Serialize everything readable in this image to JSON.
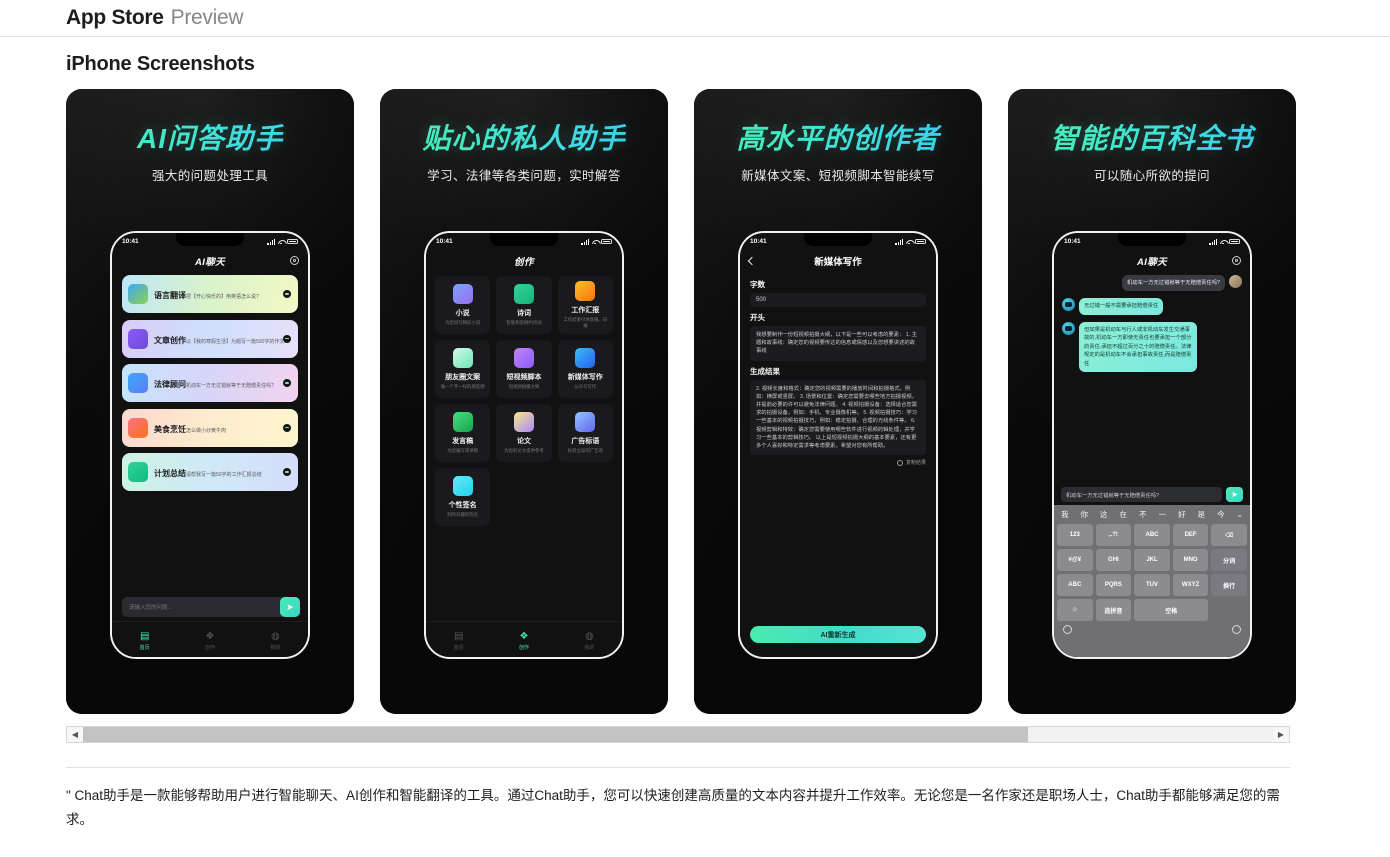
{
  "header": {
    "brand": "App Store",
    "preview": "Preview"
  },
  "section": {
    "title": "iPhone Screenshots"
  },
  "scrollbar": {
    "left_arrow": "◀",
    "right_arrow": "▶"
  },
  "footer": {
    "description": "\" Chat助手是一款能够帮助用户进行智能聊天、AI创作和智能翻译的工具。通过Chat助手，您可以快速创建高质量的文本内容并提升工作效率。无论您是一名作家还是职场人士，Chat助手都能够满足您的需求。"
  },
  "shots": [
    {
      "headline": "AI问答助手",
      "subline": "强大的问题处理工具",
      "phone": {
        "time": "10:41",
        "nav_title": "AI聊天",
        "cards": [
          {
            "title": "语言翻译",
            "sub": "把【开心快乐的】用英语怎么说?",
            "g": "linear-gradient(100deg,#bfe6f7,#d9f3c9,#f3f7c6)",
            "ig": "linear-gradient(140deg,#3da8f5,#8fd14f)"
          },
          {
            "title": "文章创作",
            "sub": "以【我的寒假生活】为题写一篇500字的作文",
            "g": "linear-gradient(100deg,#d8cdf7,#cfe0fb,#e7e0fb)",
            "ig": "linear-gradient(140deg,#8b5cf6,#6d4bd8)"
          },
          {
            "title": "法律顾问",
            "sub": "机动车一方无过错就等于无赔偿责任吗?",
            "g": "linear-gradient(100deg,#c6e4fb,#d8d5f8,#f2d3ef)",
            "ig": "linear-gradient(140deg,#3da8f5,#5b7df5)"
          },
          {
            "title": "美食烹饪",
            "sub": "怎么做小炒黄牛肉",
            "g": "linear-gradient(100deg,#fbd8d0,#fdeccd,#fdf6cf)",
            "ig": "linear-gradient(140deg,#fb7185,#f97316)"
          },
          {
            "title": "计划总结",
            "sub": "请帮我写一篇50字的工作汇报总结",
            "g": "linear-gradient(100deg,#cdf3e0,#cfe9f8,#d6dcfa)",
            "ig": "linear-gradient(140deg,#34d399,#10b981)"
          }
        ],
        "composer_placeholder": "请输入您的问题...",
        "send_icon": "➤",
        "tabs": [
          {
            "label": "首页",
            "icon": "▤",
            "active": true
          },
          {
            "label": "创作",
            "icon": "❖",
            "active": false
          },
          {
            "label": "我的",
            "icon": "◍",
            "active": false
          }
        ]
      }
    },
    {
      "headline": "贴心的私人助手",
      "subline": "学习、法律等各类问题，实时解答",
      "phone": {
        "time": "10:41",
        "nav_title": "创作",
        "grid": [
          {
            "title": "小说",
            "sub": "为您创写精彩小说",
            "ig": "linear-gradient(140deg,#7aa7f7,#9b6bf0)"
          },
          {
            "title": "诗词",
            "sub": "智能构思婉约诗词",
            "ig": "linear-gradient(140deg,#34d399,#15b37a)"
          },
          {
            "title": "工作汇报",
            "sub": "工作结果引体周报、日报",
            "ig": "linear-gradient(140deg,#fbbf24,#f97316)"
          },
          {
            "title": "朋友圈文案",
            "sub": "做一个不一样的朋友圈",
            "ig": "linear-gradient(140deg,#d1fae5,#6ee7b7)"
          },
          {
            "title": "短视频脚本",
            "sub": "短视频拍摄大纲",
            "ig": "linear-gradient(140deg,#c084fc,#8b5cf6)"
          },
          {
            "title": "新媒体写作",
            "sub": "公众号写作",
            "ig": "linear-gradient(140deg,#38bdf8,#2563eb)"
          },
          {
            "title": "发言稿",
            "sub": "为您编写演讲稿",
            "ig": "linear-gradient(140deg,#4ade80,#16a34a)"
          },
          {
            "title": "论文",
            "sub": "为您的论文提供参考",
            "ig": "linear-gradient(140deg,#fde68a,#a78bfa)"
          },
          {
            "title": "广告标语",
            "sub": "标新立异的广告语",
            "ig": "linear-gradient(140deg,#93c5fd,#6366f1)"
          },
          {
            "title": "个性签名",
            "sub": "制作有趣的签名",
            "ig": "linear-gradient(140deg,#67e8f9,#22d3ee)"
          }
        ],
        "tabs": [
          {
            "label": "首页",
            "icon": "▤",
            "active": false
          },
          {
            "label": "创作",
            "icon": "❖",
            "active": true
          },
          {
            "label": "我的",
            "icon": "◍",
            "active": false
          }
        ]
      }
    },
    {
      "headline": "高水平的创作者",
      "subline": "新媒体文案、短视频脚本智能续写",
      "phone": {
        "time": "10:41",
        "nav_title": "新媒体写作",
        "back_icon": "‹",
        "label_count": "字数",
        "value_count": "500",
        "label_start": "开头",
        "value_start": "我想要制作一份短视频拍摄大纲，以下是一些可以考虑的要素：\n1. 主题和故事线：确定您的视频要传达的信息或情感以及您想要讲述的故事线",
        "label_result": "生成结果",
        "value_result": "2. 视频长度和格式：确定您的视频需要的播放时间和拍摄格式，例如：横屏或竖屏。\n3. 场景和位置：确定您需要去哪些地方拍摄视频，并提前必要的许可以避免法律问题。\n4. 视频拍摄设备：选择适合您需求的拍摄设备，例如：手机、专业摄像机等。\n5. 视频拍摄技巧：学习一些基本的视频拍摄技巧，例如：稳定拍摄、合理的光线条件等。\n6. 视频剪辑和特效：确定您需要使用哪些软件进行视频的辑处理，并学习一些基本的剪辑技巧。\n以上是短视频拍摄大纲的基本要素，还有更多个人喜好和特定需求等考虑要素。希望对您有所帮助。",
        "copy_label": "复制结果",
        "button_label": "AI重新生成"
      }
    },
    {
      "headline": "智能的百科全书",
      "subline": "可以随心所欲的提问",
      "phone": {
        "time": "10:41",
        "nav_title": "AI聊天",
        "messages": [
          {
            "from": "me",
            "text": "机动车一方无过错就等于无赔偿责任吗?"
          },
          {
            "from": "ai",
            "text": "无过错一般不需要承担赔偿责任"
          },
          {
            "from": "ai",
            "text": "但如果是机动车与行人或非机动车发生交通事故的,机动车一方即使无责任也要承担一个部分的责任,承担不超过百分之十的赔偿责任。法律规定的是机动车不会承担事故责任,而是赔偿责任"
          }
        ],
        "input_value": "机动车一方无过错就等于无赔偿责任吗?",
        "send_icon": "➤",
        "keyboard": {
          "suggestions": [
            "我",
            "你",
            "这",
            "在",
            "不",
            "一",
            "好",
            "是",
            "今"
          ],
          "expand_icon": "⌄",
          "keys": [
            "123",
            ",.?!",
            "ABC",
            "DEF",
            "⌫",
            "#@¥",
            "GHI",
            "JKL",
            "MNO",
            "分词",
            "ABC",
            "PQRS",
            "TUV",
            "WXYZ",
            "换行",
            "☺",
            "选拼音",
            "空格"
          ],
          "globe_icon": "⊕",
          "mic_icon": "⊙"
        }
      }
    }
  ]
}
